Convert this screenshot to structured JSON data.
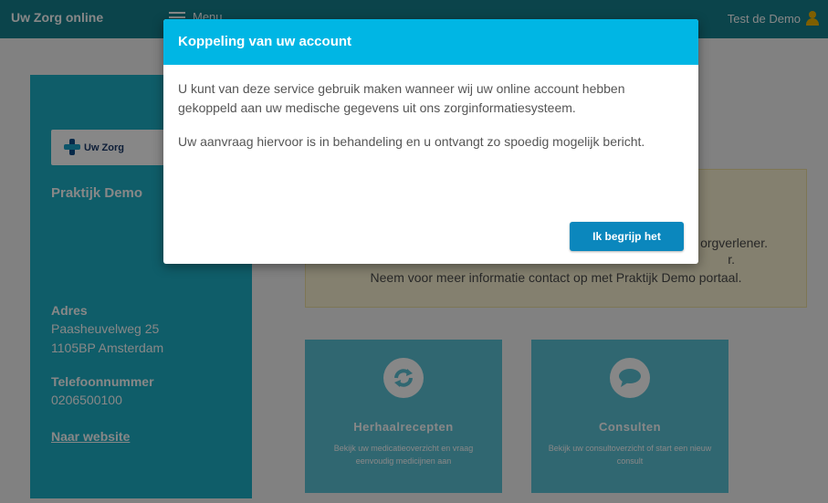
{
  "topbar": {
    "brand": "Uw Zorg online",
    "menu_label": "Menu",
    "user_name": "Test de Demo"
  },
  "sidebar": {
    "logo_text": "Uw Zorg",
    "practice_name": "Praktijk Demo",
    "address_label": "Adres",
    "address_line1": "Paasheuvelweg 25",
    "address_line2": "1105BP Amsterdam",
    "phone_label": "Telefoonnummer",
    "phone_value": "0206500100",
    "website_link": "Naar website"
  },
  "notice": {
    "line1": "orgverlener.",
    "line2": "r.",
    "line3": "Neem voor meer informatie contact op met Praktijk Demo portaal."
  },
  "tiles": [
    {
      "title": "Herhaalrecepten",
      "desc": "Bekijk uw medicatieoverzicht en vraag eenvoudig medicijnen aan"
    },
    {
      "title": "Consulten",
      "desc": "Bekijk uw consultoverzicht of start een nieuw consult"
    }
  ],
  "modal": {
    "title": "Koppeling van uw account",
    "paragraph1": "U kunt van deze service gebruik maken wanneer wij uw online account hebben gekoppeld aan uw medische gegevens uit ons zorginformatiesysteem.",
    "paragraph2": "Uw aanvraag hiervoor is in behandeling en u ontvangt zo spoedig mogelijk bericht.",
    "button_label": "Ik begrijp het"
  },
  "colors": {
    "topbar": "#16818f",
    "sidebar": "#1db0c6",
    "modal_header": "#00b6e4",
    "button": "#0b87bd",
    "notice_bg": "#f9f2d2",
    "user_icon": "#f0b400"
  },
  "icons": [
    "menu-icon",
    "user-icon",
    "uw-zorg-logo-icon",
    "refresh-icon",
    "chat-bubble-icon"
  ]
}
